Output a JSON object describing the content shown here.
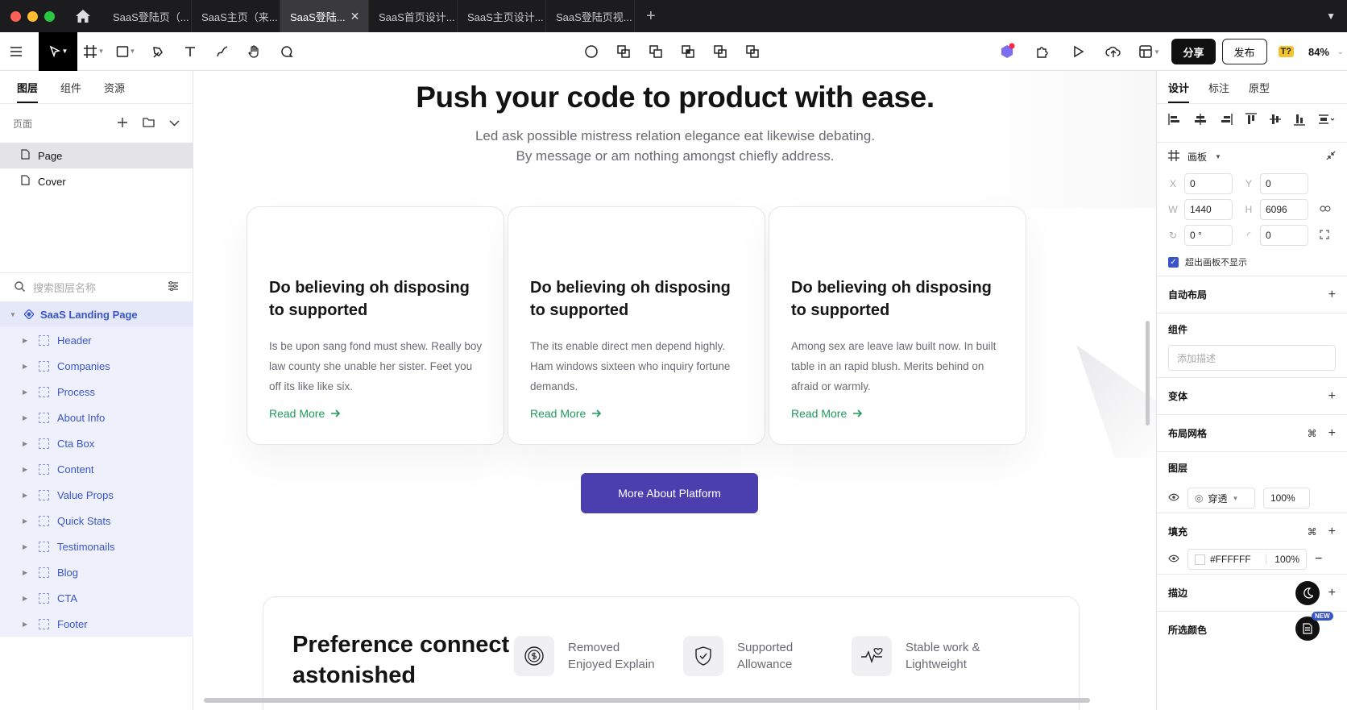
{
  "tabs": [
    {
      "label": "SaaS登陆页（..."
    },
    {
      "label": "SaaS主页（来..."
    },
    {
      "label": "SaaS登陆..."
    },
    {
      "label": "SaaS首页设计..."
    },
    {
      "label": "SaaS主页设计..."
    },
    {
      "label": "SaaS登陆页视..."
    }
  ],
  "toolbar": {
    "share": "分享",
    "publish": "发布",
    "badge": "T?",
    "zoom": "84%"
  },
  "left_panel": {
    "tabs": [
      "图层",
      "组件",
      "资源"
    ],
    "pages_header": "页面",
    "pages": [
      "Page",
      "Cover"
    ],
    "search_placeholder": "搜索图层名称",
    "root_layer": "SaaS Landing Page",
    "layers": [
      "Header",
      "Companies",
      "Process",
      "About Info",
      "Cta Box",
      "Content",
      "Value Props",
      "Quick Stats",
      "Testimonails",
      "Blog",
      "CTA",
      "Footer"
    ]
  },
  "canvas": {
    "headline": "Push your code to product with ease.",
    "subtitle_line1": "Led ask possible mistress relation elegance eat likewise debating.",
    "subtitle_line2": "By message or am nothing amongst chiefly address.",
    "cards": [
      {
        "title": "Do believing oh disposing to supported",
        "body": "Is be upon sang fond must shew. Really boy law county she unable her sister. Feet you off its like like six.",
        "link": "Read More"
      },
      {
        "title": "Do believing oh disposing to supported",
        "body": "The its enable direct men depend highly. Ham windows sixteen who inquiry fortune demands.",
        "link": "Read More"
      },
      {
        "title": "Do believing oh disposing to supported",
        "body": "Among sex are leave law built now. In built table in an rapid blush. Merits behind on afraid or warmly.",
        "link": "Read More"
      }
    ],
    "cta_button": "More About Platform",
    "bottom_title": "Preference connect astonished",
    "features": [
      {
        "line1": "Removed",
        "line2": "Enjoyed Explain",
        "icon": "dollar-cycle-icon"
      },
      {
        "line1": "Supported",
        "line2": "Allowance",
        "icon": "shield-icon"
      },
      {
        "line1": "Stable work &",
        "line2": "Lightweight",
        "icon": "heartbeat-icon"
      }
    ]
  },
  "right_panel": {
    "tabs": [
      "设计",
      "标注",
      "原型"
    ],
    "frame_label": "画板",
    "x_label": "X",
    "x": "0",
    "y_label": "Y",
    "y": "0",
    "w_label": "W",
    "w": "1440",
    "h_label": "H",
    "h": "6096",
    "rotation": "0 °",
    "radius": "0",
    "clip_label": "超出画板不显示",
    "auto_layout": "自动布局",
    "component": "组件",
    "component_desc_placeholder": "添加描述",
    "variant": "变体",
    "layout_grid": "布局网格",
    "layer": "图层",
    "blend": "穿透",
    "opacity": "100%",
    "fill": "填充",
    "fill_hex": "#FFFFFF",
    "fill_opacity": "100%",
    "stroke": "描边",
    "selected_colors": "所选颜色",
    "new_badge": "NEW"
  },
  "colors": {
    "accent": "#4b3fb0",
    "link": "#1f9a5a",
    "layer_blue": "#3b55c8"
  }
}
